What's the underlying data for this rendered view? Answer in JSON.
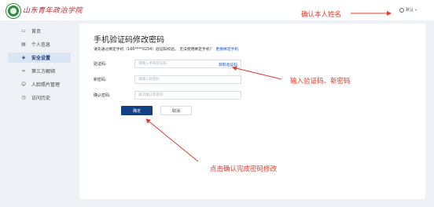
{
  "header": {
    "logo_text": "山东青年政治学院",
    "user_name": "默认"
  },
  "sidebar": {
    "items": [
      {
        "label": "首页",
        "icon": "monitor-icon",
        "active": false
      },
      {
        "label": "个人信息",
        "icon": "id-card-icon",
        "active": false
      },
      {
        "label": "安全设置",
        "icon": "shield-icon",
        "active": true
      },
      {
        "label": "第三方解绑",
        "icon": "link-icon",
        "active": false
      },
      {
        "label": "人脸照片管理",
        "icon": "person-icon",
        "active": false
      },
      {
        "label": "访问历史",
        "icon": "history-icon",
        "active": false
      }
    ]
  },
  "form": {
    "title": "手机验证码修改密码",
    "hint": "请先通过绑定手机（166****0234）验证码校验。 无法使用绑定手机？",
    "hint_link": "更换绑定手机",
    "code_label": "验证码:",
    "code_placeholder": "请输入手机验证码",
    "send_code": "获取验证码",
    "new_pwd_label": "新密码:",
    "new_pwd_placeholder": "请输入新密码",
    "confirm_pwd_label": "确认密码:",
    "confirm_pwd_placeholder": "再次确认新密码",
    "ok_label": "确定",
    "cancel_label": "取消"
  },
  "annotations": {
    "confirm_name": "确认本人姓名",
    "input_code": "输入验证码、新密码",
    "click_confirm": "点击确认完成密码修改",
    "color": "#e23a2e"
  }
}
